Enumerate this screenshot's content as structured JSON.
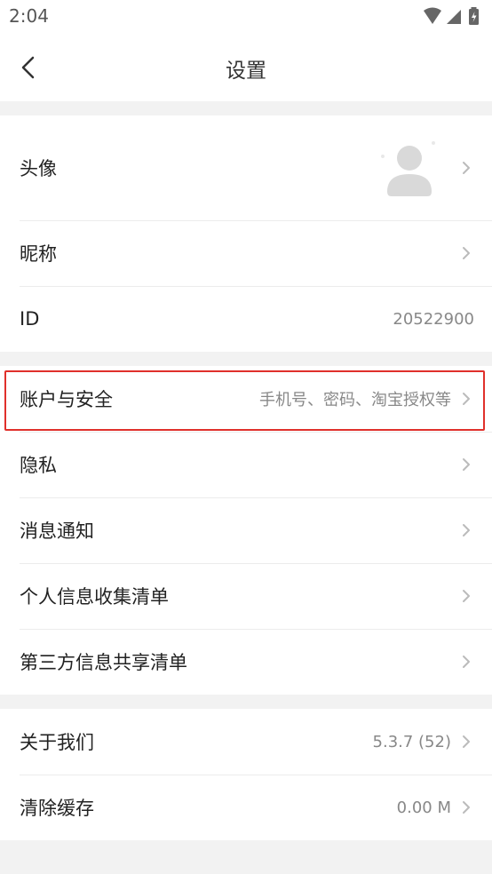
{
  "status_bar": {
    "time": "2:04"
  },
  "nav": {
    "title": "设置"
  },
  "profile": {
    "avatar_label": "头像",
    "nickname_label": "昵称",
    "id_label": "ID",
    "id_value": "20522900"
  },
  "account": {
    "security_label": "账户与安全",
    "security_value": "手机号、密码、淘宝授权等",
    "privacy_label": "隐私",
    "notifications_label": "消息通知",
    "info_collection_label": "个人信息收集清单",
    "third_party_label": "第三方信息共享清单"
  },
  "about": {
    "about_label": "关于我们",
    "version_value": "5.3.7 (52)",
    "clear_cache_label": "清除缓存",
    "cache_value": "0.00 M"
  },
  "colors": {
    "highlight": "#e0302b",
    "background": "#f2f2f2"
  }
}
